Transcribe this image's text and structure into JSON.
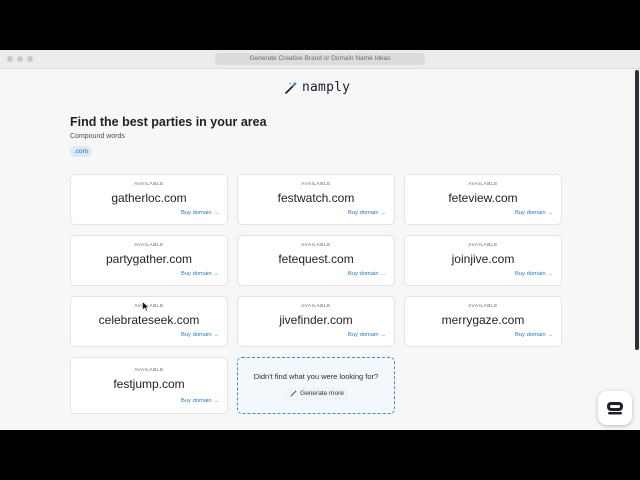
{
  "browser": {
    "url_title": "Generate Creative Brand or Domain Name Ideas"
  },
  "header": {
    "logo_text": "namply",
    "logo_icon": "magic-wand-icon"
  },
  "page": {
    "heading": "Find the best parties in your area",
    "category": "Compound words",
    "tld_filter": ".com"
  },
  "results": [
    {
      "status": "AVAILABLE",
      "domain": "gatherloc.com",
      "action": "Buy domain →"
    },
    {
      "status": "AVAILABLE",
      "domain": "festwatch.com",
      "action": "Buy domain →"
    },
    {
      "status": "AVAILABLE",
      "domain": "feteview.com",
      "action": "Buy domain →"
    },
    {
      "status": "AVAILABLE",
      "domain": "partygather.com",
      "action": "Buy domain →"
    },
    {
      "status": "AVAILABLE",
      "domain": "fetequest.com",
      "action": "Buy domain →"
    },
    {
      "status": "AVAILABLE",
      "domain": "joinjive.com",
      "action": "Buy domain →"
    },
    {
      "status": "AVAILABLE",
      "domain": "celebrateseek.com",
      "action": "Buy domain →"
    },
    {
      "status": "AVAILABLE",
      "domain": "jivefinder.com",
      "action": "Buy domain →"
    },
    {
      "status": "AVAILABLE",
      "domain": "merrygaze.com",
      "action": "Buy domain →"
    },
    {
      "status": "AVAILABLE",
      "domain": "festjump.com",
      "action": "Buy domain →"
    }
  ],
  "more": {
    "question": "Didn't find what you were looking for?",
    "button_label": "Generate more",
    "button_icon": "magic-wand-icon"
  },
  "colors": {
    "accent": "#2a78c2",
    "chip_bg": "#dbeaf7",
    "dashed_border": "#3a8dd6"
  }
}
